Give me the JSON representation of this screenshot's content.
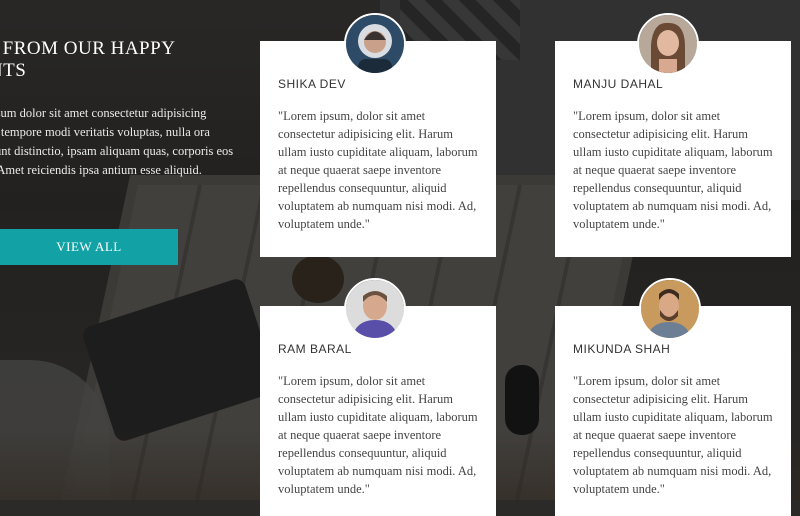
{
  "section": {
    "title_line1": "AR FROM OUR HAPPY",
    "title_line2": "IENTS",
    "intro_text": "m, ipsum dolor sit amet consectetur adipisicing Quod tempore modi veritatis voluptas, nulla ora incidunt distinctio, ipsam aliquam quas, corporis eos quis. Amet reiciendis ipsa antium esse aliquid.",
    "view_all_label": "VIEW ALL"
  },
  "colors": {
    "accent": "#12a2a6",
    "card_bg": "#ffffff"
  },
  "testimonials": [
    {
      "name": "SHIKA DEV",
      "avatar_icon": "person-avatar-woman-hood",
      "avatar_color": "#2d4a66",
      "quote": "\"Lorem ipsum, dolor sit amet consectetur adipisicing elit. Harum ullam iusto cupiditate aliquam, laborum at neque quaerat saepe inventore repellendus consequuntur, aliquid voluptatem ab numquam nisi modi. Ad, voluptatem unde.\""
    },
    {
      "name": "MANJU DAHAL",
      "avatar_icon": "person-avatar-woman",
      "avatar_color": "#8a6a55",
      "quote": "\"Lorem ipsum, dolor sit amet consectetur adipisicing elit. Harum ullam iusto cupiditate aliquam, laborum at neque quaerat saepe inventore repellendus consequuntur, aliquid voluptatem ab numquam nisi modi. Ad, voluptatem unde.\""
    },
    {
      "name": "RAM BARAL",
      "avatar_icon": "person-avatar-man",
      "avatar_color": "#5a4fa8",
      "quote": "\"Lorem ipsum, dolor sit amet consectetur adipisicing elit. Harum ullam iusto cupiditate aliquam, laborum at neque quaerat saepe inventore repellendus consequuntur, aliquid voluptatem ab numquam nisi modi. Ad, voluptatem unde.\""
    },
    {
      "name": "MIKUNDA SHAH",
      "avatar_icon": "person-avatar-man-beard",
      "avatar_color": "#9a7a55",
      "quote": "\"Lorem ipsum, dolor sit amet consectetur adipisicing elit. Harum ullam iusto cupiditate aliquam, laborum at neque quaerat saepe inventore repellendus consequuntur, aliquid voluptatem ab numquam nisi modi. Ad, voluptatem unde.\""
    }
  ]
}
